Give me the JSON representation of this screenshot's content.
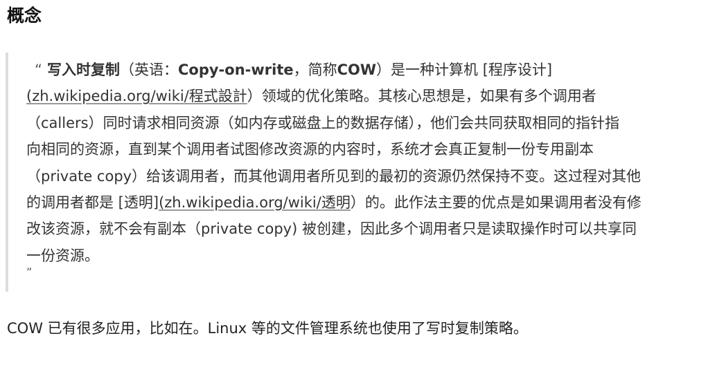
{
  "heading": "概念",
  "quote": {
    "open_mark": "“",
    "term": "写入时复制",
    "paren_open": "（英语：",
    "english_term": "Copy-on-write",
    "abbr_prefix": "，简称",
    "abbr": "COW",
    "after_abbr": "）是一种计算机 [程序设计]",
    "link1": "(zh.wikipedia.org/wiki/",
    "link1_tail": "程式設計",
    "line2_rest": "）领域的优化策略。其核心思想是，如果有多个调用者",
    "line3": "（callers）同时请求相同资源（如内存或磁盘上的数据存储），他们会共同获取相同的指针指",
    "line4": "向相同的资源，直到某个调用者试图修改资源的内容时，系统才会真正复制一份专用副本",
    "line5": "（private copy）给该调用者，而其他调用者所见到的最初的资源仍然保持不变。这过程对其他",
    "line6_a": "的调用者都是 [透明]",
    "link2": "(zh.wikipedia.org/wiki/",
    "link2_tail": "透明",
    "line6_b": "）的。此作法主要的优点是如果调用者没有修",
    "line7": "改该资源，就不会有副本（private copy) 被创建，因此多个调用者只是读取操作时可以共享同",
    "line8": "一份资源。",
    "close_mark": "”"
  },
  "paragraph": "COW 已有很多应用，比如在。Linux 等的文件管理系统也使用了写时复制策略。"
}
